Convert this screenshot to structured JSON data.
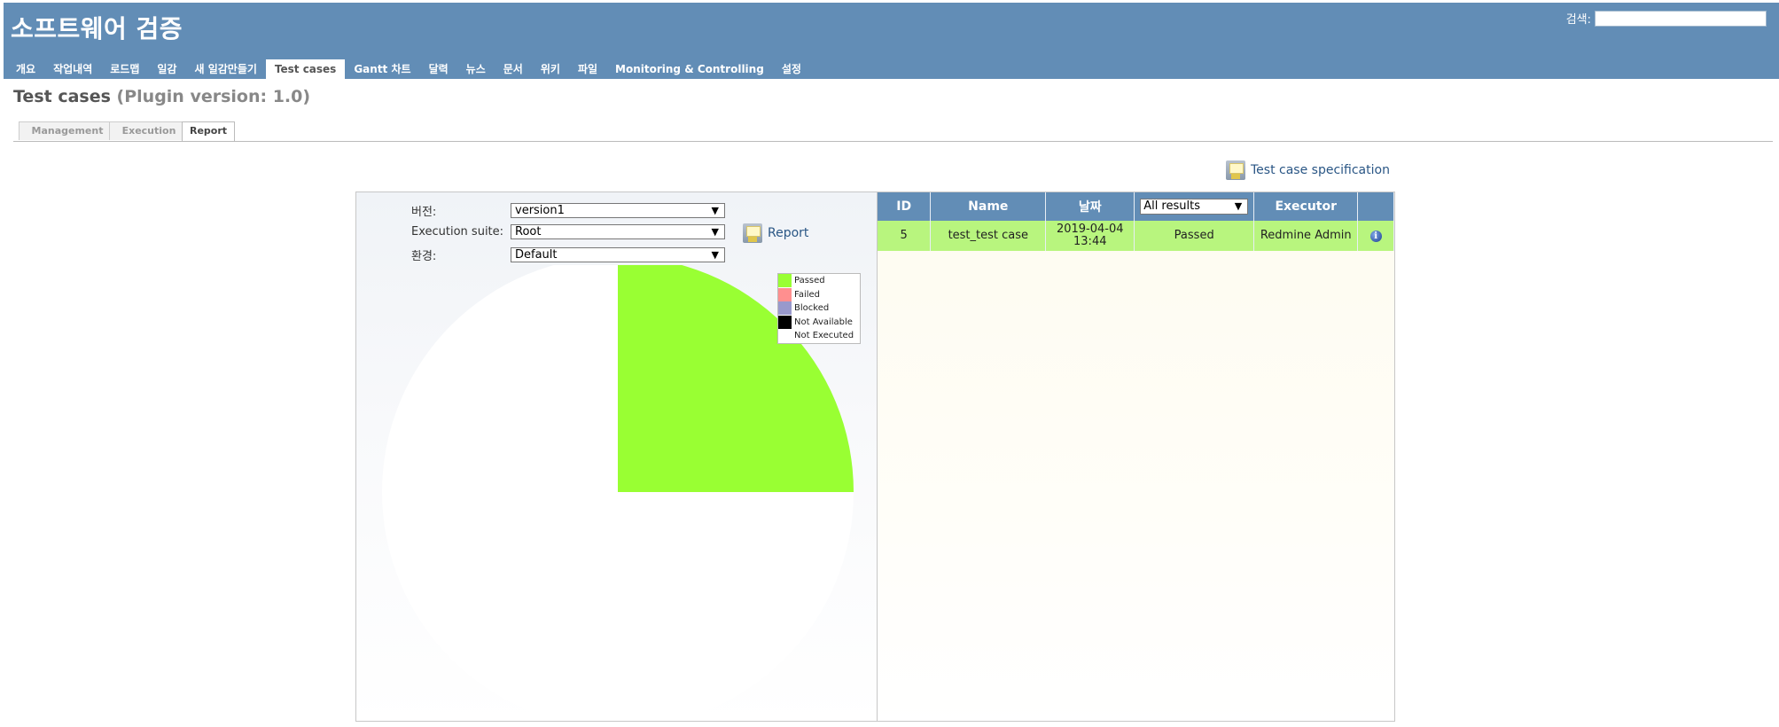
{
  "header": {
    "app_title": "소프트웨어 검증",
    "search_label": "검색:",
    "search_value": ""
  },
  "menu": [
    {
      "label": "개요"
    },
    {
      "label": "작업내역"
    },
    {
      "label": "로드맵"
    },
    {
      "label": "일감"
    },
    {
      "label": "새 일감만들기"
    },
    {
      "label": "Test cases",
      "selected": true
    },
    {
      "label": "Gantt 차트"
    },
    {
      "label": "달력"
    },
    {
      "label": "뉴스"
    },
    {
      "label": "문서"
    },
    {
      "label": "위키"
    },
    {
      "label": "파일"
    },
    {
      "label": "Monitoring & Controlling"
    },
    {
      "label": "설정"
    }
  ],
  "page": {
    "title": "Test cases",
    "subtitle": "(Plugin version: 1.0)"
  },
  "tabs": [
    {
      "label": "Management"
    },
    {
      "label": "Execution"
    },
    {
      "label": "Report",
      "selected": true
    }
  ],
  "spec_link": "Test case specification",
  "filters": {
    "version_label": "버전:",
    "version_value": "version1",
    "suite_label": "Execution suite:",
    "suite_value": "Root",
    "env_label": "환경:",
    "env_value": "Default"
  },
  "report_link": "Report",
  "chart_data": {
    "type": "pie",
    "categories": [
      "Passed",
      "Failed",
      "Blocked",
      "Not Available",
      "Not Executed"
    ],
    "values": [
      1,
      0,
      0,
      0,
      3
    ],
    "colors": [
      "#99ff33",
      "#ff8f8f",
      "#9999cc",
      "#000000",
      "#ffffff"
    ],
    "legend_position": "top-right",
    "title": ""
  },
  "results": {
    "columns": [
      "ID",
      "Name",
      "날짜",
      "",
      "Executor",
      ""
    ],
    "filter_value": "All results",
    "rows": [
      {
        "id": "5",
        "name": "test_test case",
        "date": "2019-04-04",
        "time": "13:44",
        "result": "Passed",
        "executor": "Redmine Admin",
        "info": "i"
      }
    ]
  },
  "colors": {
    "header_bg": "#628db6",
    "passed_row": "#b8f57e",
    "link": "#2a5685"
  }
}
